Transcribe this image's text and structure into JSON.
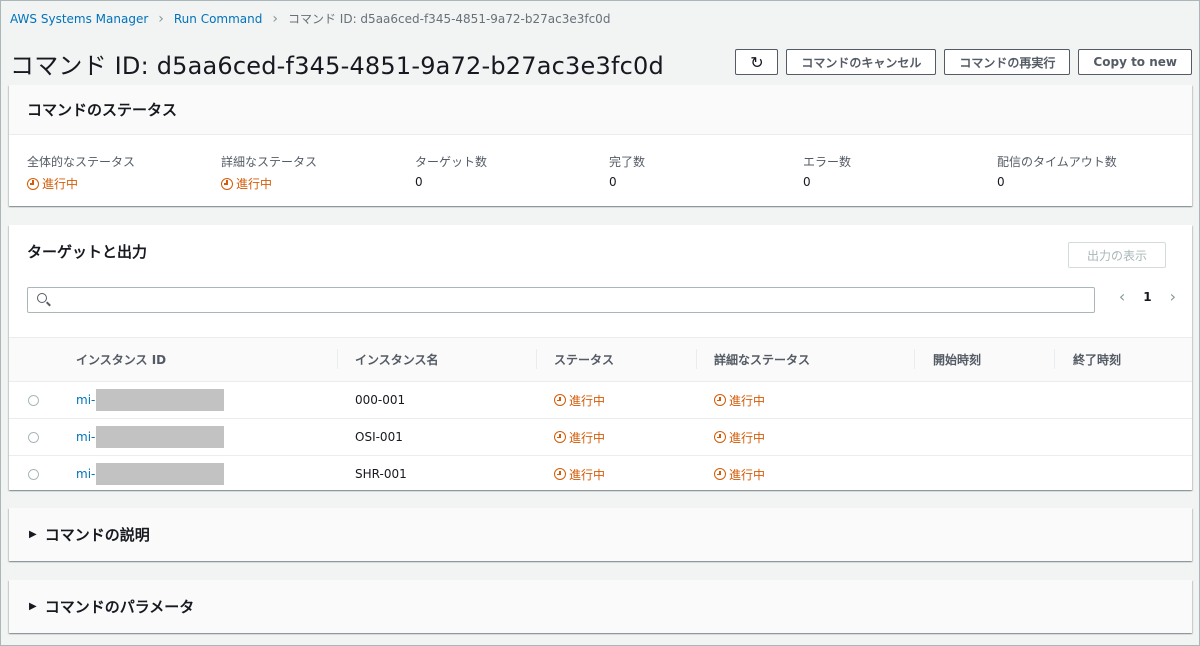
{
  "breadcrumb": {
    "items": [
      "AWS Systems Manager",
      "Run Command"
    ],
    "current": "コマンド ID: d5aa6ced-f345-4851-9a72-b27ac3e3fc0d"
  },
  "title": "コマンド ID: d5aa6ced-f345-4851-9a72-b27ac3e3fc0d",
  "actions": {
    "refresh_icon": "↻",
    "cancel": "コマンドのキャンセル",
    "rerun": "コマンドの再実行",
    "copy": "Copy to new"
  },
  "status_panel": {
    "title": "コマンドのステータス",
    "stats": [
      {
        "label": "全体的なステータス",
        "value": "進行中",
        "in_progress": true
      },
      {
        "label": "詳細なステータス",
        "value": "進行中",
        "in_progress": true
      },
      {
        "label": "ターゲット数",
        "value": "0"
      },
      {
        "label": "完了数",
        "value": "0"
      },
      {
        "label": "エラー数",
        "value": "0"
      },
      {
        "label": "配信のタイムアウト数",
        "value": "0"
      }
    ]
  },
  "targets_panel": {
    "title": "ターゲットと出力",
    "show_output": "出力の表示",
    "search_placeholder": "",
    "page": "1",
    "columns": [
      "インスタンス ID",
      "インスタンス名",
      "ステータス",
      "詳細なステータス",
      "開始時刻",
      "終了時刻"
    ],
    "rows": [
      {
        "id_prefix": "mi-",
        "name": "000-001",
        "status": "進行中",
        "detail": "進行中",
        "start": "",
        "end": ""
      },
      {
        "id_prefix": "mi-",
        "name": "OSI-001",
        "status": "進行中",
        "detail": "進行中",
        "start": "",
        "end": ""
      },
      {
        "id_prefix": "mi-",
        "name": "SHR-001",
        "status": "進行中",
        "detail": "進行中",
        "start": "",
        "end": ""
      }
    ]
  },
  "sections": {
    "description": "コマンドの説明",
    "parameters": "コマンドのパラメータ"
  },
  "colors": {
    "link": "#0073bb",
    "in_progress": "#d45b07",
    "background": "#f2f3f3"
  }
}
